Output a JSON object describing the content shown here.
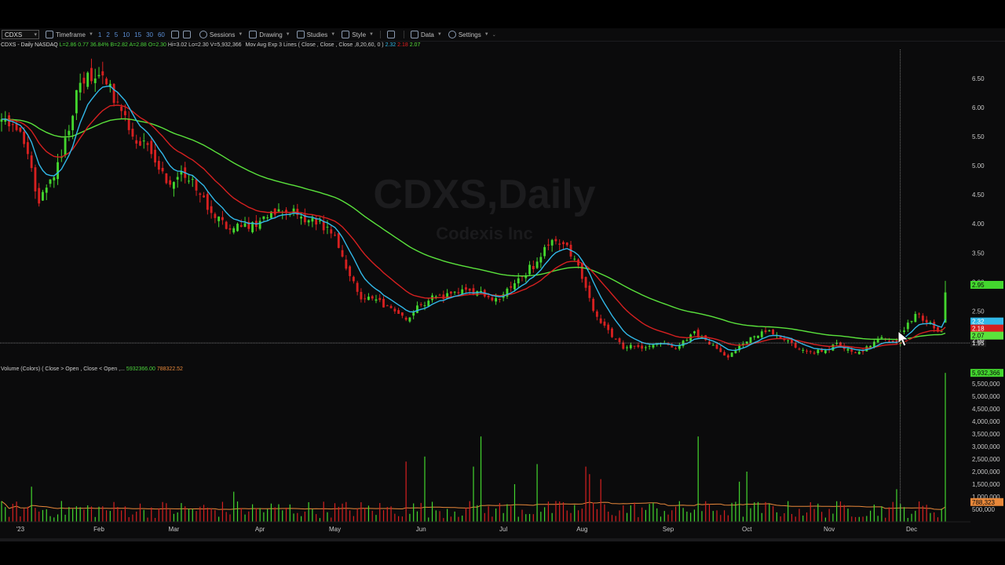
{
  "toolbar": {
    "symbol": "CDXS",
    "timeframe_label": "Timeframe",
    "timeframes": [
      "1",
      "2",
      "5",
      "10",
      "15",
      "30",
      "60"
    ],
    "sessions_label": "Sessions",
    "drawing_label": "Drawing",
    "studies_label": "Studies",
    "style_label": "Style",
    "data_label": "Data",
    "settings_label": "Settings"
  },
  "header": {
    "symbol_line": "CDXS - Daily  NASDAQ",
    "stats": [
      {
        "text": "L=2.86",
        "color": "#4cd43c"
      },
      {
        "text": "0.77",
        "color": "#4cd43c"
      },
      {
        "text": "36.84%",
        "color": "#4cd43c"
      },
      {
        "text": "B=2.82",
        "color": "#4cd43c"
      },
      {
        "text": "A=2.88",
        "color": "#4cd43c"
      },
      {
        "text": "O=2.30",
        "color": "#4cd43c"
      },
      {
        "text": "Hi=3.02",
        "color": "#cccccc"
      },
      {
        "text": "Lo=2.30",
        "color": "#cccccc"
      },
      {
        "text": "V=5,932,366",
        "color": "#cccccc"
      }
    ],
    "study_label": "Mov Avg Exp 3 Lines ( Close , Close , Close ,8,20,60, 0 )",
    "study_values": [
      {
        "text": "2.32",
        "color": "#31b8e8"
      },
      {
        "text": "2.18",
        "color": "#e02020"
      },
      {
        "text": "2.07",
        "color": "#5ae23c"
      }
    ]
  },
  "volume_header": {
    "label": "Volume (Colors) ( Close > Open , Close < Open ,...",
    "values": [
      {
        "text": "5932366.00",
        "color": "#4cd43c"
      },
      {
        "text": "788322.52",
        "color": "#e8883a"
      }
    ]
  },
  "watermark": {
    "symbol": "CDXS,Daily",
    "company": "Codexis Inc"
  },
  "colors": {
    "up": "#43d62e",
    "down": "#d62020",
    "ema8": "#31b8e8",
    "ema20": "#d62020",
    "ema60": "#5ae23c",
    "volume_avg": "#e8883a"
  },
  "chart_data": {
    "type": "candlestick",
    "ticker": "CDXS",
    "interval": "Daily",
    "x_month_labels": [
      "'23",
      "Feb",
      "Mar",
      "Apr",
      "May",
      "Jun",
      "Jul",
      "Aug",
      "Sep",
      "Oct",
      "Nov",
      "Dec"
    ],
    "price_axis_ticks": [
      "6.50",
      "6.00",
      "5.50",
      "5.00",
      "4.50",
      "4.00",
      "3.50",
      "3.00",
      "2.50",
      "2.00"
    ],
    "price_ylim": [
      1.6,
      7.0
    ],
    "price_markers": [
      {
        "text": "2.95",
        "color": "#43d62e"
      },
      {
        "text": "2.32",
        "color": "#31b8e8"
      },
      {
        "text": "2.18",
        "color": "#d62020"
      },
      {
        "text": "2.07",
        "color": "#5ae23c"
      }
    ],
    "crosshair_price": "1.95",
    "volume_axis_ticks": [
      "5,500,000",
      "5,000,000",
      "4,500,000",
      "4,000,000",
      "3,500,000",
      "3,000,000",
      "2,500,000",
      "2,000,000",
      "1,500,000",
      "1,000,000",
      "500,000"
    ],
    "volume_markers": [
      {
        "text": "5,932,366",
        "color": "#43d62e"
      },
      {
        "text": "788,323",
        "color": "#e8883a"
      }
    ],
    "volume_ylim": [
      0,
      6000000
    ],
    "close_anchors": [
      {
        "date": "2022-12-27",
        "close": 5.8
      },
      {
        "date": "2022-12-30",
        "close": 5.7
      },
      {
        "date": "2023-01-05",
        "close": 5.2
      },
      {
        "date": "2023-01-10",
        "close": 4.35
      },
      {
        "date": "2023-01-16",
        "close": 4.8
      },
      {
        "date": "2023-01-20",
        "close": 5.6
      },
      {
        "date": "2023-01-24",
        "close": 6.3
      },
      {
        "date": "2023-01-27",
        "close": 6.6
      },
      {
        "date": "2023-01-31",
        "close": 6.5
      },
      {
        "date": "2023-02-03",
        "close": 6.4
      },
      {
        "date": "2023-02-08",
        "close": 6.1
      },
      {
        "date": "2023-02-14",
        "close": 5.5
      },
      {
        "date": "2023-02-21",
        "close": 5.2
      },
      {
        "date": "2023-02-27",
        "close": 4.7
      },
      {
        "date": "2023-03-03",
        "close": 4.9
      },
      {
        "date": "2023-03-10",
        "close": 4.5
      },
      {
        "date": "2023-03-16",
        "close": 4.1
      },
      {
        "date": "2023-03-22",
        "close": 3.9
      },
      {
        "date": "2023-03-27",
        "close": 3.95
      },
      {
        "date": "2023-04-03",
        "close": 4.05
      },
      {
        "date": "2023-04-10",
        "close": 4.25
      },
      {
        "date": "2023-04-17",
        "close": 4.15
      },
      {
        "date": "2023-04-21",
        "close": 4.1
      },
      {
        "date": "2023-04-27",
        "close": 3.95
      },
      {
        "date": "2023-05-01",
        "close": 3.8
      },
      {
        "date": "2023-05-05",
        "close": 3.1
      },
      {
        "date": "2023-05-10",
        "close": 2.7
      },
      {
        "date": "2023-05-16",
        "close": 2.7
      },
      {
        "date": "2023-05-22",
        "close": 2.55
      },
      {
        "date": "2023-05-26",
        "close": 2.35
      },
      {
        "date": "2023-06-01",
        "close": 2.6
      },
      {
        "date": "2023-06-07",
        "close": 2.75
      },
      {
        "date": "2023-06-13",
        "close": 2.8
      },
      {
        "date": "2023-06-20",
        "close": 2.85
      },
      {
        "date": "2023-06-26",
        "close": 2.75
      },
      {
        "date": "2023-06-30",
        "close": 2.7
      },
      {
        "date": "2023-07-05",
        "close": 2.9
      },
      {
        "date": "2023-07-10",
        "close": 3.1
      },
      {
        "date": "2023-07-14",
        "close": 3.35
      },
      {
        "date": "2023-07-18",
        "close": 3.6
      },
      {
        "date": "2023-07-21",
        "close": 3.7
      },
      {
        "date": "2023-07-25",
        "close": 3.65
      },
      {
        "date": "2023-07-28",
        "close": 3.4
      },
      {
        "date": "2023-08-02",
        "close": 2.9
      },
      {
        "date": "2023-08-07",
        "close": 2.4
      },
      {
        "date": "2023-08-11",
        "close": 2.05
      },
      {
        "date": "2023-08-16",
        "close": 1.85
      },
      {
        "date": "2023-08-21",
        "close": 1.9
      },
      {
        "date": "2023-08-25",
        "close": 1.9
      },
      {
        "date": "2023-08-30",
        "close": 1.95
      },
      {
        "date": "2023-09-05",
        "close": 1.85
      },
      {
        "date": "2023-09-08",
        "close": 2.0
      },
      {
        "date": "2023-09-12",
        "close": 2.15
      },
      {
        "date": "2023-09-15",
        "close": 2.0
      },
      {
        "date": "2023-09-20",
        "close": 1.85
      },
      {
        "date": "2023-09-25",
        "close": 1.7
      },
      {
        "date": "2023-09-28",
        "close": 1.9
      },
      {
        "date": "2023-10-03",
        "close": 2.05
      },
      {
        "date": "2023-10-06",
        "close": 2.15
      },
      {
        "date": "2023-10-11",
        "close": 2.1
      },
      {
        "date": "2023-10-16",
        "close": 2.0
      },
      {
        "date": "2023-10-20",
        "close": 1.85
      },
      {
        "date": "2023-10-25",
        "close": 1.8
      },
      {
        "date": "2023-10-30",
        "close": 1.8
      },
      {
        "date": "2023-11-03",
        "close": 1.95
      },
      {
        "date": "2023-11-08",
        "close": 1.85
      },
      {
        "date": "2023-11-13",
        "close": 1.8
      },
      {
        "date": "2023-11-16",
        "close": 1.9
      },
      {
        "date": "2023-11-21",
        "close": 2.05
      },
      {
        "date": "2023-11-27",
        "close": 1.95
      },
      {
        "date": "2023-11-30",
        "close": 2.3
      },
      {
        "date": "2023-12-04",
        "close": 2.45
      },
      {
        "date": "2023-12-07",
        "close": 2.3
      },
      {
        "date": "2023-12-11",
        "close": 2.2
      },
      {
        "date": "2023-12-13",
        "close": 2.15
      },
      {
        "date": "2023-12-14",
        "close": 2.82
      }
    ],
    "volume_spikes": [
      {
        "date": "2023-01-06",
        "volume": 1400000,
        "up": true
      },
      {
        "date": "2023-03-23",
        "volume": 1200000,
        "up": true
      },
      {
        "date": "2023-05-26",
        "volume": 2400000,
        "up": false
      },
      {
        "date": "2023-06-02",
        "volume": 2600000,
        "up": true
      },
      {
        "date": "2023-06-21",
        "volume": 2200000,
        "up": true
      },
      {
        "date": "2023-06-23",
        "volume": 3400000,
        "up": true
      },
      {
        "date": "2023-07-06",
        "volume": 1500000,
        "up": true
      },
      {
        "date": "2023-07-14",
        "volume": 2300000,
        "up": true
      },
      {
        "date": "2023-08-02",
        "volume": 2200000,
        "up": false
      },
      {
        "date": "2023-08-03",
        "volume": 1900000,
        "up": false
      },
      {
        "date": "2023-08-08",
        "volume": 1700000,
        "up": false
      },
      {
        "date": "2023-09-13",
        "volume": 3400000,
        "up": true
      },
      {
        "date": "2023-09-28",
        "volume": 1600000,
        "up": true
      },
      {
        "date": "2023-10-02",
        "volume": 2000000,
        "up": true
      },
      {
        "date": "2023-11-27",
        "volume": 1300000,
        "up": true
      },
      {
        "date": "2023-12-14",
        "volume": 5932366,
        "up": true
      }
    ],
    "crosshair_date": "2023-11-28"
  }
}
